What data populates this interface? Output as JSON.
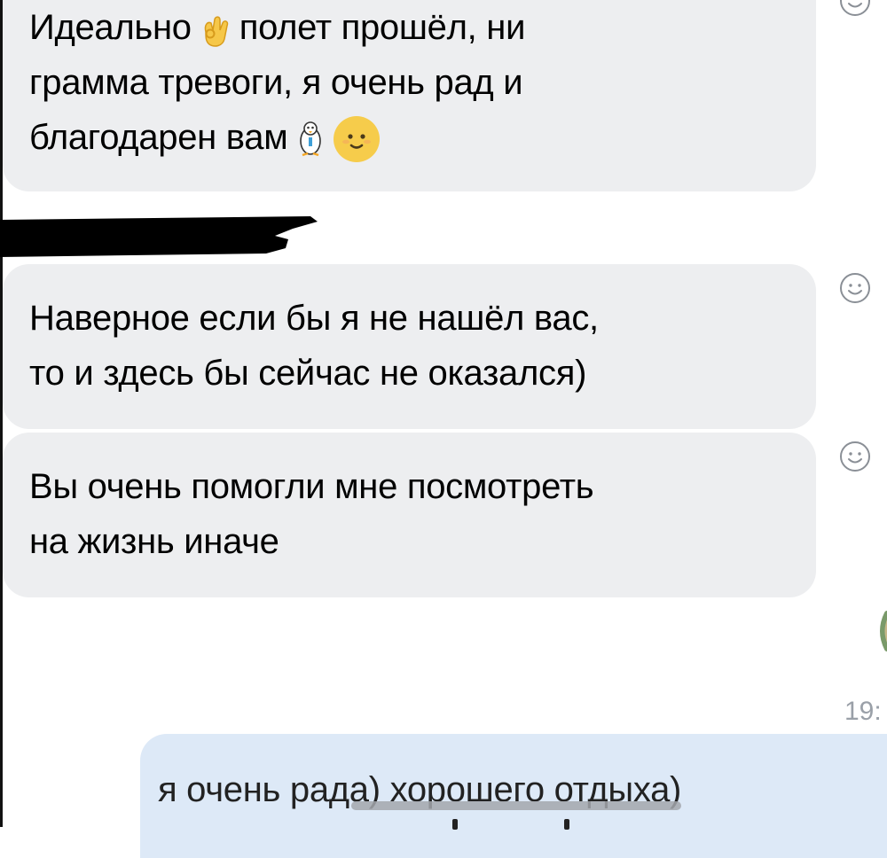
{
  "messages": [
    {
      "direction": "incoming",
      "lines": {
        "l1_a": "Идеально",
        "l1_b": "полет прошёл, ни",
        "l2": "грамма тревоги, я очень рад и",
        "l3": "благодарен вам"
      },
      "emoji": [
        "ok-hand",
        "penguin",
        "smiling-face"
      ]
    },
    {
      "direction": "incoming",
      "lines": {
        "l1": "Наверное если бы я не нашёл вас,",
        "l2": "то и здесь бы сейчас не оказался)"
      }
    },
    {
      "direction": "incoming",
      "lines": {
        "l1": "Вы очень помогли мне посмотреть",
        "l2": "на жизнь иначе"
      }
    },
    {
      "direction": "outgoing",
      "text": "я очень рада) хорошего отдыха)"
    }
  ],
  "timestamp": "19:",
  "reaction_icon": "smiley-reaction-icon",
  "colors": {
    "incoming_bubble": "#edeef0",
    "outgoing_bubble": "#dde9f7",
    "text": "#222222",
    "timestamp": "#9aa0a8",
    "redaction": "#000000"
  }
}
